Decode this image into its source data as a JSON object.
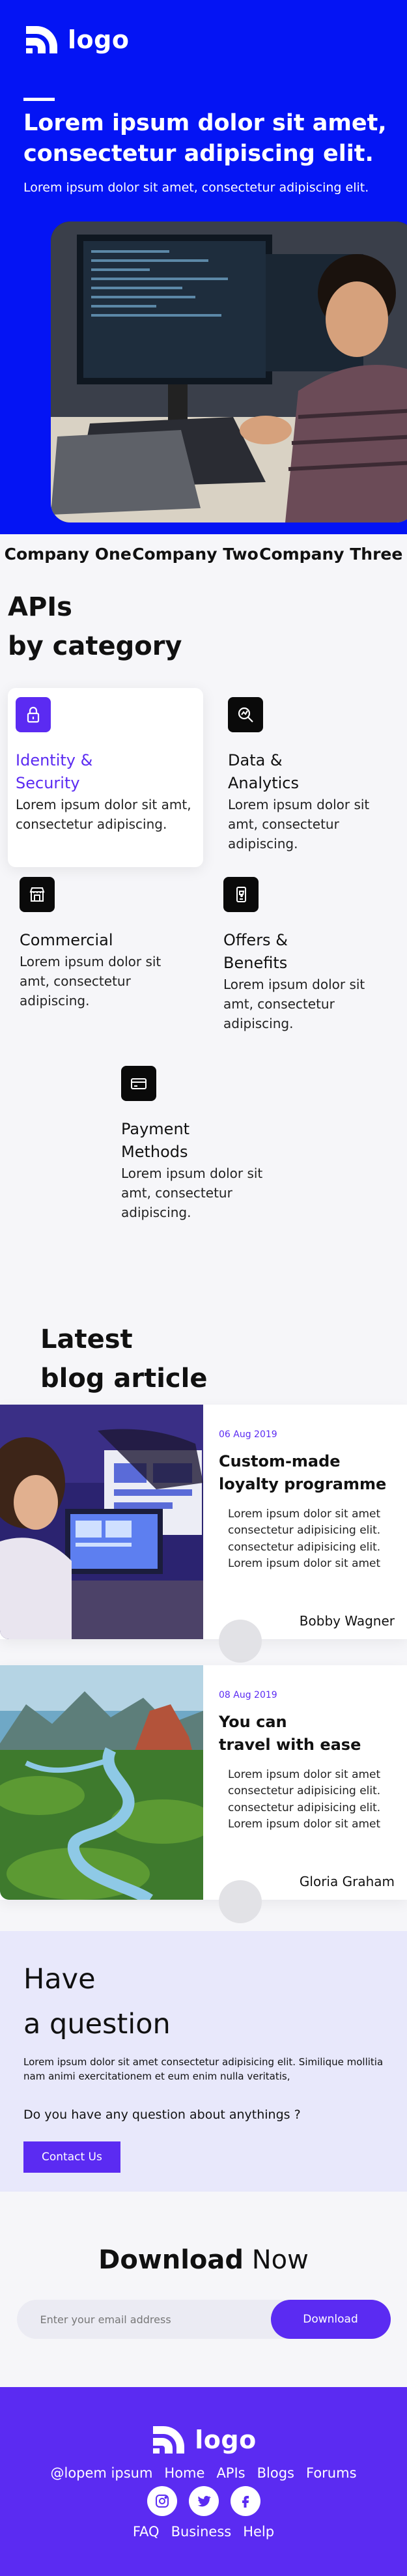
{
  "header": {
    "logo_text": "logo",
    "title": "Lorem ipsum dolor sit amet, consectetur adipiscing elit.",
    "subtitle": "Lorem ipsum dolor sit amet, consectetur adipiscing elit."
  },
  "companies": [
    "Company One",
    "Company Two",
    "Company Three"
  ],
  "apis": {
    "title_line1": "APIs",
    "title_line2": "by category",
    "items": [
      {
        "name_line1": "Identity &",
        "name_line2": "Security",
        "desc": "Lorem ipsum dolor sit amt, consectetur adipiscing.",
        "icon": "lock-icon",
        "active": true
      },
      {
        "name_line1": "Data &",
        "name_line2": "Analytics",
        "desc": "Lorem ipsum dolor sit amt, consectetur adipiscing.",
        "icon": "magnifier-chart-icon"
      },
      {
        "name_line1": "Commercial",
        "name_line2": "",
        "desc": "Lorem ipsum dolor sit amt, consectetur adipiscing.",
        "icon": "storefront-icon"
      },
      {
        "name_line1": "Offers &",
        "name_line2": "Benefits",
        "desc": "Lorem ipsum dolor sit amt, consectetur adipiscing.",
        "icon": "phone-tag-icon"
      },
      {
        "name_line1": "Payment",
        "name_line2": "Methods",
        "desc": "Lorem ipsum dolor sit amt, consectetur adipiscing.",
        "icon": "credit-card-icon"
      }
    ]
  },
  "blog": {
    "title_line1": "Latest",
    "title_line2": "blog article",
    "posts": [
      {
        "date": "06 Aug 2019",
        "title_line1": "Custom-made",
        "title_line2": "loyalty programme",
        "text": "Lorem ipsum dolor sit amet consectetur adipisicing elit. consectetur adipisicing elit. Lorem ipsum dolor sit amet",
        "author": "Bobby Wagner"
      },
      {
        "date": "08 Aug 2019",
        "title_line1": "You can",
        "title_line2": "travel with ease",
        "text": "Lorem ipsum dolor sit amet consectetur adipisicing elit. consectetur adipisicing elit. Lorem ipsum dolor sit amet",
        "author": "Gloria Graham"
      }
    ]
  },
  "question": {
    "title_line1": "Have",
    "title_line2": "a question",
    "text": "Lorem ipsum dolor sit amet consectetur adipisicing elit. Similique mollitia nam animi exercitationem et eum enim nulla veritatis,",
    "ask": "Do you have any question about anythings ?",
    "button": "Contact Us"
  },
  "download": {
    "title_bold": "Download",
    "title_rest": " Now",
    "placeholder": "Enter your email address",
    "button": "Download"
  },
  "footer": {
    "logo_text": "logo",
    "links": [
      "@lopem ipsum",
      "Home",
      "APIs",
      "Blogs",
      "Forums"
    ],
    "social": [
      "instagram-icon",
      "twitter-icon",
      "facebook-icon"
    ],
    "links2": [
      "FAQ",
      "Business",
      "Help"
    ]
  },
  "colors": {
    "hero_blue": "#0414f4",
    "accent_purple": "#5b2bf2"
  }
}
